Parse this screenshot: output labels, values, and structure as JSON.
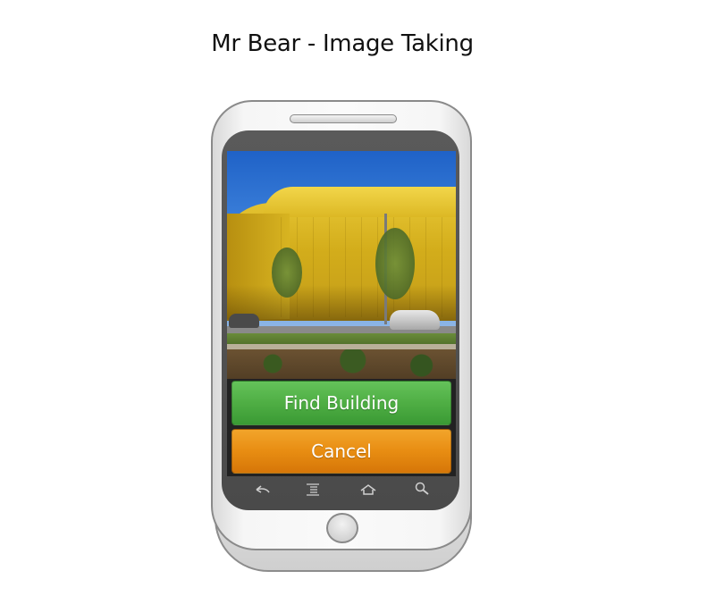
{
  "page": {
    "title": "Mr Bear - Image Taking"
  },
  "buttons": {
    "find_building": "Find Building",
    "cancel": "Cancel"
  },
  "colors": {
    "find_building_bg": "#4fae44",
    "cancel_bg": "#e88d12"
  },
  "navbar": {
    "items": [
      {
        "icon": "back-icon"
      },
      {
        "icon": "menu-icon"
      },
      {
        "icon": "home-icon"
      },
      {
        "icon": "search-icon"
      }
    ]
  }
}
